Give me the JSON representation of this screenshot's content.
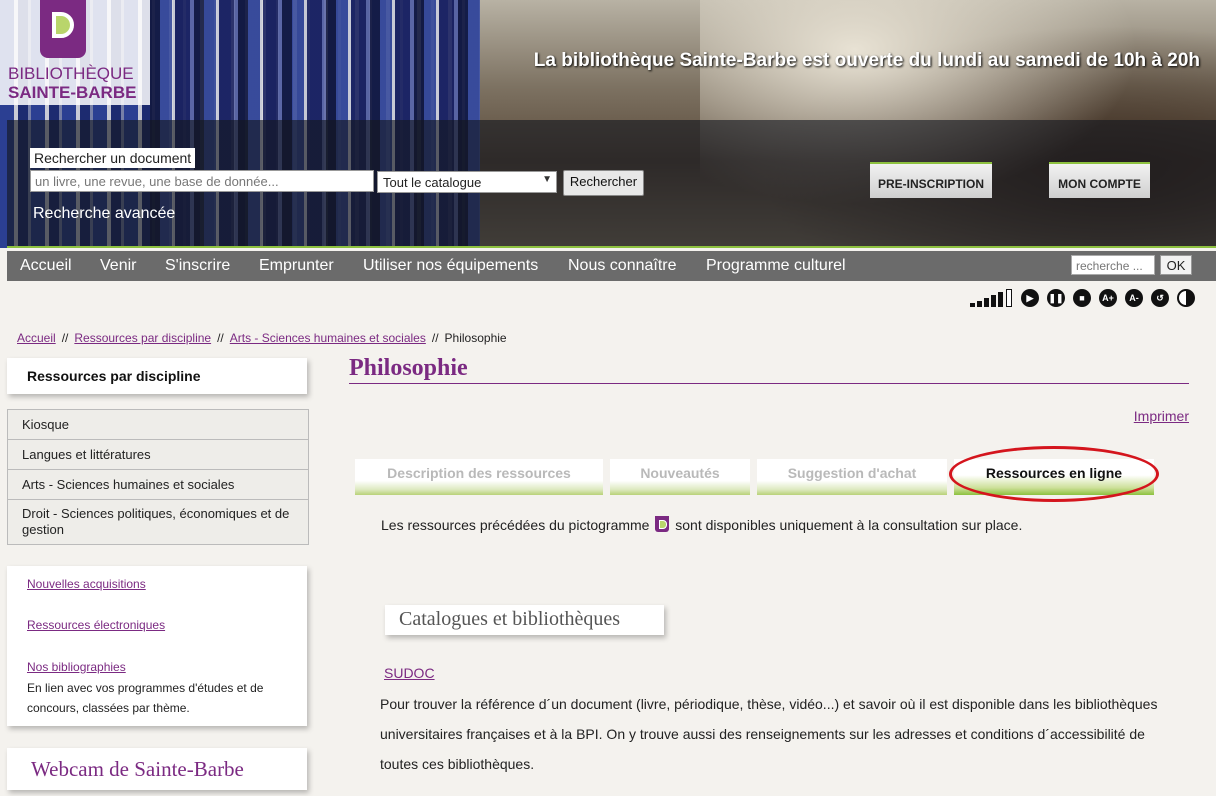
{
  "header": {
    "logo_line1": "BIBLIOTHÈQUE",
    "logo_line2": "SAINTE-BARBE",
    "opening_hours": "La bibliothèque Sainte-Barbe est ouverte du lundi au samedi de 10h à 20h",
    "search_label": "Rechercher un document",
    "search_placeholder": "un livre, une revue, une base de donnée...",
    "catalog_selected": "Tout le catalogue",
    "search_button": "Rechercher",
    "advanced_search": "Recherche avancée",
    "preinscription_button": "PRE-INSCRIPTION",
    "account_button": "MON COMPTE"
  },
  "nav": {
    "items": [
      "Accueil",
      "Venir",
      "S'inscrire",
      "Emprunter",
      "Utiliser nos équipements",
      "Nous connaître",
      "Programme culturel"
    ],
    "search_placeholder": "recherche ...",
    "ok_label": "OK"
  },
  "tools": {
    "icons": [
      "text-size-icon",
      "play-icon",
      "pause-icon",
      "stop-icon",
      "zoom-in-icon",
      "zoom-out-icon",
      "reset-icon",
      "contrast-icon"
    ],
    "zoom_in": "A+",
    "zoom_out": "A-"
  },
  "breadcrumb": {
    "items": [
      "Accueil",
      "Ressources par discipline",
      "Arts - Sciences humaines et sociales"
    ],
    "current": "Philosophie",
    "separator": "//"
  },
  "sidebar": {
    "title": "Ressources par discipline",
    "disciplines": [
      "Kiosque",
      "Langues et littératures",
      "Arts - Sciences humaines et sociales",
      "Droit - Sciences politiques, économiques et de gestion"
    ],
    "links": [
      "Nouvelles acquisitions",
      "Ressources électroniques",
      "Nos bibliographies"
    ],
    "bibliographies_desc": "En lien avec vos programmes d'études et de concours, classées par thème.",
    "webcam_title": "Webcam de Sainte-Barbe"
  },
  "main": {
    "title": "Philosophie",
    "print": "Imprimer",
    "tabs": [
      "Description des ressources",
      "Nouveautés",
      "Suggestion d'achat",
      "Ressources en ligne"
    ],
    "active_tab": "Ressources en ligne",
    "notice_before": "Les ressources précédées du pictogramme",
    "notice_after": "sont disponibles uniquement à la consultation sur place.",
    "section_title": "Catalogues et bibliothèques",
    "sudoc_link": "SUDOC",
    "sudoc_desc": "Pour trouver la référence d´un document (livre, périodique, thèse, vidéo...) et savoir où il est disponible dans les bibliothèques universitaires françaises et à la BPI. On y trouve aussi des renseignements sur les adresses et conditions d´accessibilité de toutes ces bibliothèques."
  },
  "colors": {
    "brand_purple": "#7b2a82",
    "accent_green": "#8dc13f",
    "nav_gray": "#6b6b6b",
    "highlight_red": "#d4151d"
  }
}
